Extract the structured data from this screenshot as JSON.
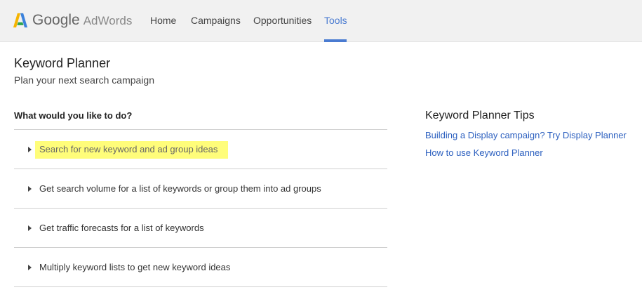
{
  "header": {
    "logo_google": "Google",
    "logo_adwords": "AdWords",
    "nav": [
      {
        "label": "Home",
        "active": false
      },
      {
        "label": "Campaigns",
        "active": false
      },
      {
        "label": "Opportunities",
        "active": false
      },
      {
        "label": "Tools",
        "active": true
      }
    ],
    "accent_color": "#4a7bd1",
    "logo_icon": "adwords-logo-icon"
  },
  "main": {
    "title": "Keyword Planner",
    "subtitle": "Plan your next search campaign",
    "question": "What would you like to do?",
    "options": [
      {
        "label": "Search for new keyword and ad group ideas",
        "highlighted": true
      },
      {
        "label": "Get search volume for a list of keywords or group them into ad groups",
        "highlighted": false
      },
      {
        "label": "Get traffic forecasts for a list of keywords",
        "highlighted": false
      },
      {
        "label": "Multiply keyword lists to get new keyword ideas",
        "highlighted": false
      }
    ],
    "highlight_color": "#fffd7a",
    "option_icon": "triangle-right-icon"
  },
  "tips": {
    "title": "Keyword Planner Tips",
    "links": [
      "Building a Display campaign? Try Display Planner",
      "How to use Keyword Planner"
    ],
    "link_color": "#2b5fbf"
  }
}
